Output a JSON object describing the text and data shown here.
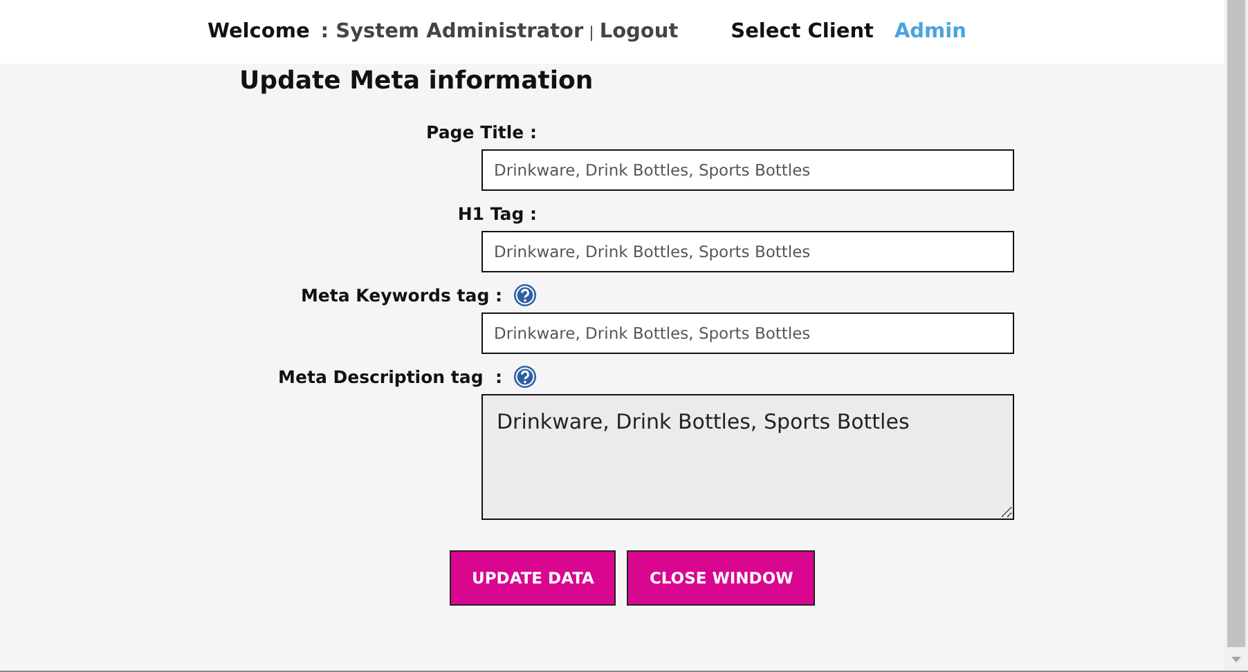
{
  "header": {
    "welcome": "Welcome",
    "user": ": System Administrator",
    "separator": "|",
    "logout": "Logout",
    "select_client": "Select Client",
    "client": "Admin"
  },
  "title": "Update Meta information",
  "fields": [
    {
      "label": "Page Title :",
      "kind": "input",
      "help": false,
      "value": "Drinkware, Drink Bottles, Sports Bottles"
    },
    {
      "label": "H1 Tag :",
      "kind": "input",
      "help": false,
      "value": "Drinkware, Drink Bottles, Sports Bottles"
    },
    {
      "label": "Meta Keywords tag :",
      "kind": "input",
      "help": true,
      "value": "Drinkware, Drink Bottles, Sports Bottles"
    },
    {
      "label": "Meta Description tag  :",
      "kind": "textarea",
      "help": true,
      "value": "Drinkware, Drink Bottles, Sports Bottles"
    }
  ],
  "buttons": [
    "UPDATE DATA",
    "CLOSE WINDOW"
  ]
}
